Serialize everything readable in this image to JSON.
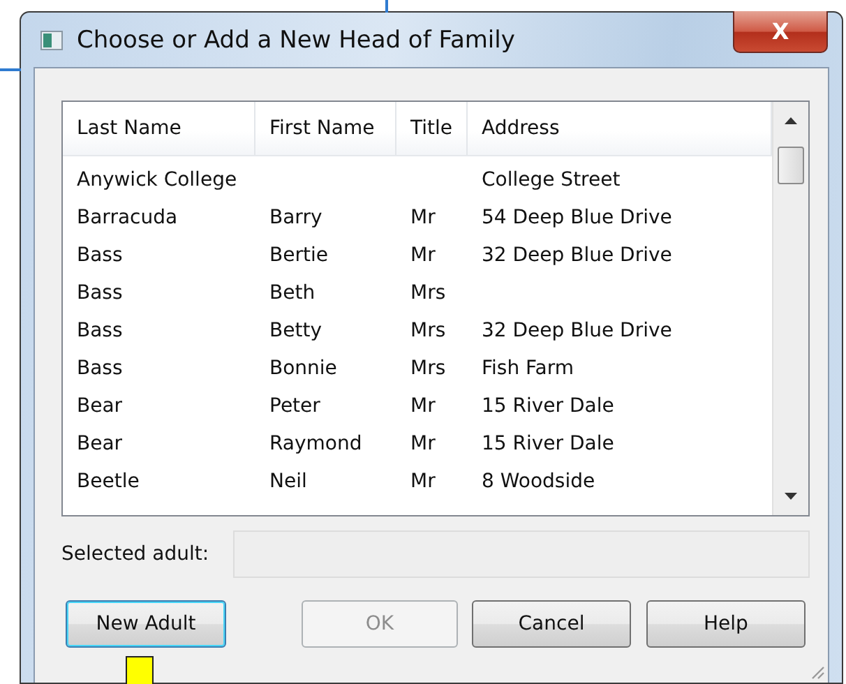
{
  "window": {
    "title": "Choose or Add a New Head of Family",
    "close": "X"
  },
  "list": {
    "columns": [
      "Last Name",
      "First Name",
      "Title",
      "Address"
    ],
    "rows": [
      {
        "last_name": "Anywick College",
        "address": "College Street"
      },
      {
        "last_name": "Barracuda",
        "first_name": "Barry",
        "title": "Mr",
        "address": "54 Deep Blue Drive"
      },
      {
        "last_name": "Bass",
        "first_name": "Bertie",
        "title": "Mr",
        "address": "32 Deep Blue Drive"
      },
      {
        "last_name": "Bass",
        "first_name": "Beth",
        "title": "Mrs"
      },
      {
        "last_name": "Bass",
        "first_name": "Betty",
        "title": "Mrs",
        "address": "32 Deep Blue Drive"
      },
      {
        "last_name": "Bass",
        "first_name": "Bonnie",
        "title": "Mrs",
        "address": "Fish Farm"
      },
      {
        "last_name": "Bear",
        "first_name": "Peter",
        "title": "Mr",
        "address": "15 River Dale"
      },
      {
        "last_name": "Bear",
        "first_name": "Raymond",
        "title": "Mr",
        "address": "15 River Dale"
      },
      {
        "last_name": "Beetle",
        "first_name": "Neil",
        "title": "Mr",
        "address": "8 Woodside"
      }
    ]
  },
  "selected_adult": {
    "label": "Selected adult:"
  },
  "buttons": [
    {
      "label": "New Adult",
      "disabled": false,
      "focused": true
    },
    {
      "label": "OK",
      "disabled": true,
      "focused": false
    },
    {
      "label": "Cancel",
      "disabled": false,
      "focused": false
    },
    {
      "label": "Help",
      "disabled": false,
      "focused": false
    }
  ]
}
